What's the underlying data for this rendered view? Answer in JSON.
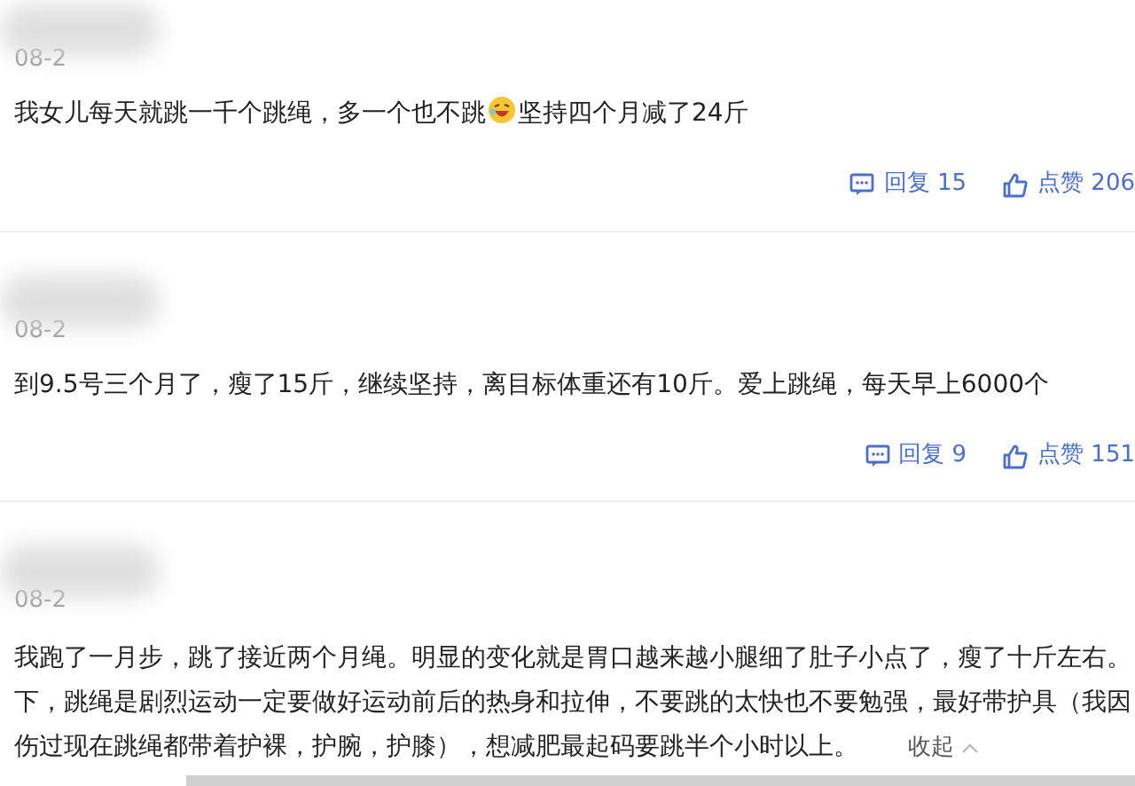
{
  "comments": [
    {
      "date": "08-2",
      "segments": [
        {
          "kind": "text",
          "text": "我女儿每天就跳一千个跳绳，多一个也不跳"
        },
        {
          "kind": "emoji"
        },
        {
          "kind": "text",
          "text": "坚持四个月减了24斤"
        }
      ],
      "reply": "回复 15",
      "like": "点赞 206"
    },
    {
      "date": "08-2",
      "segments": [
        {
          "kind": "text",
          "text": "到9.5号三个月了，瘦了15斤，继续坚持，离目标体重还有10斤。爱上跳绳，每天早上6000个"
        }
      ],
      "reply": "回复 9",
      "like": "点赞 151"
    },
    {
      "date": "08-2",
      "lines": [
        "我跑了一月步，跳了接近两个月绳。明显的变化就是胃口越来越小腿细了肚子小点了，瘦了十斤左右。",
        "下，跳绳是剧烈运动一定要做好运动前后的热身和拉伸，不要跳的太快也不要勉强，最好带护具（我因",
        "伤过现在跳绳都带着护裸，护腕，护膝），想减肥最起码要跳半个小时以上。"
      ],
      "collapse": "收起"
    }
  ]
}
